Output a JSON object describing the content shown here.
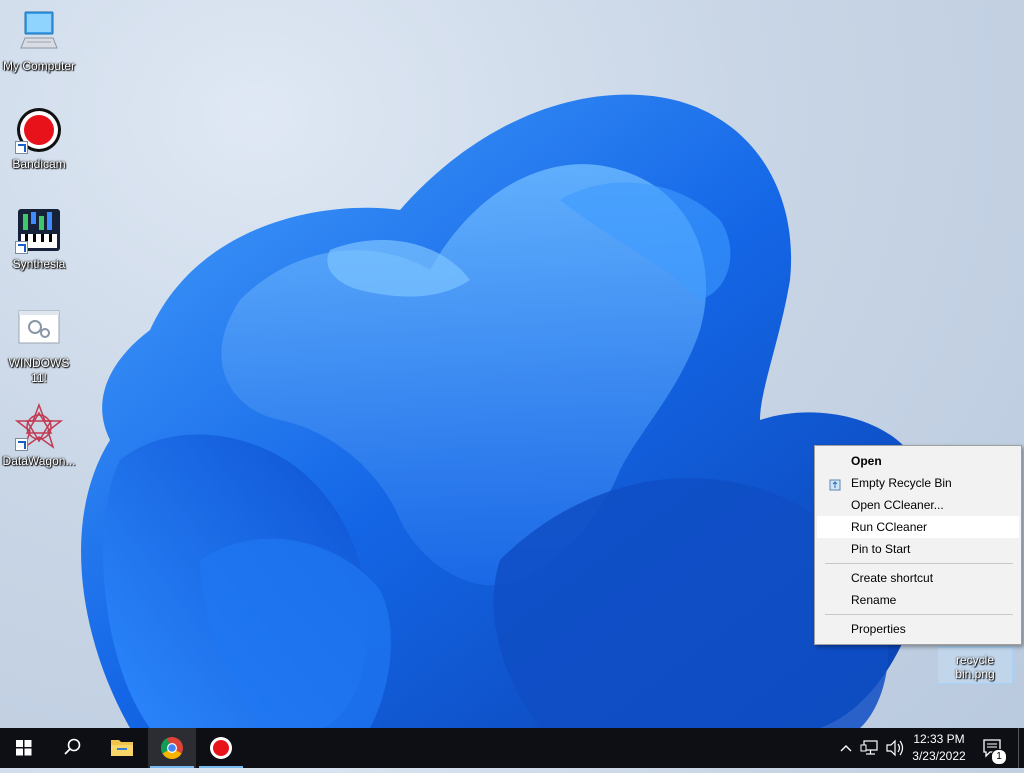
{
  "desktop": {
    "icons": [
      {
        "label": "My Computer",
        "icon": "computer-icon"
      },
      {
        "label": "Bandicam",
        "icon": "bandicam-icon"
      },
      {
        "label": "Synthesia",
        "icon": "synthesia-icon"
      },
      {
        "label": "WINDOWS 11!",
        "icon": "windows11-file-icon"
      },
      {
        "label": "DataWagon...",
        "icon": "datawagon-icon"
      }
    ],
    "selected_file": {
      "label": "recycle bin.png"
    }
  },
  "context_menu": {
    "items": [
      {
        "label": "Open",
        "bold": true
      },
      {
        "label": "Empty Recycle Bin",
        "icon": "recycle-bin-icon"
      },
      {
        "label": "Open CCleaner..."
      },
      {
        "label": "Run CCleaner",
        "highlighted": true
      },
      {
        "label": "Pin to Start"
      },
      {
        "label": "Create shortcut"
      },
      {
        "label": "Rename"
      },
      {
        "label": "Properties"
      }
    ]
  },
  "taskbar": {
    "buttons": [
      {
        "name": "start-button",
        "icon": "windows-logo-icon"
      },
      {
        "name": "search-button",
        "icon": "search-icon"
      },
      {
        "name": "file-explorer-button",
        "icon": "folder-icon"
      },
      {
        "name": "chrome-button",
        "icon": "chrome-icon"
      },
      {
        "name": "bandicam-button",
        "icon": "bandicam-icon"
      }
    ],
    "tray": {
      "time": "12:33 PM",
      "date": "3/23/2022",
      "notification_count": "1",
      "icons": [
        "chevron-up-icon",
        "network-icon",
        "volume-icon",
        "notification-icon"
      ]
    }
  },
  "colors": {
    "taskbar_bg": "#0d0f14",
    "menu_bg": "#f2f2f2",
    "accent": "#76b9ed",
    "wallpaper_blue": "#1a6ff0"
  }
}
